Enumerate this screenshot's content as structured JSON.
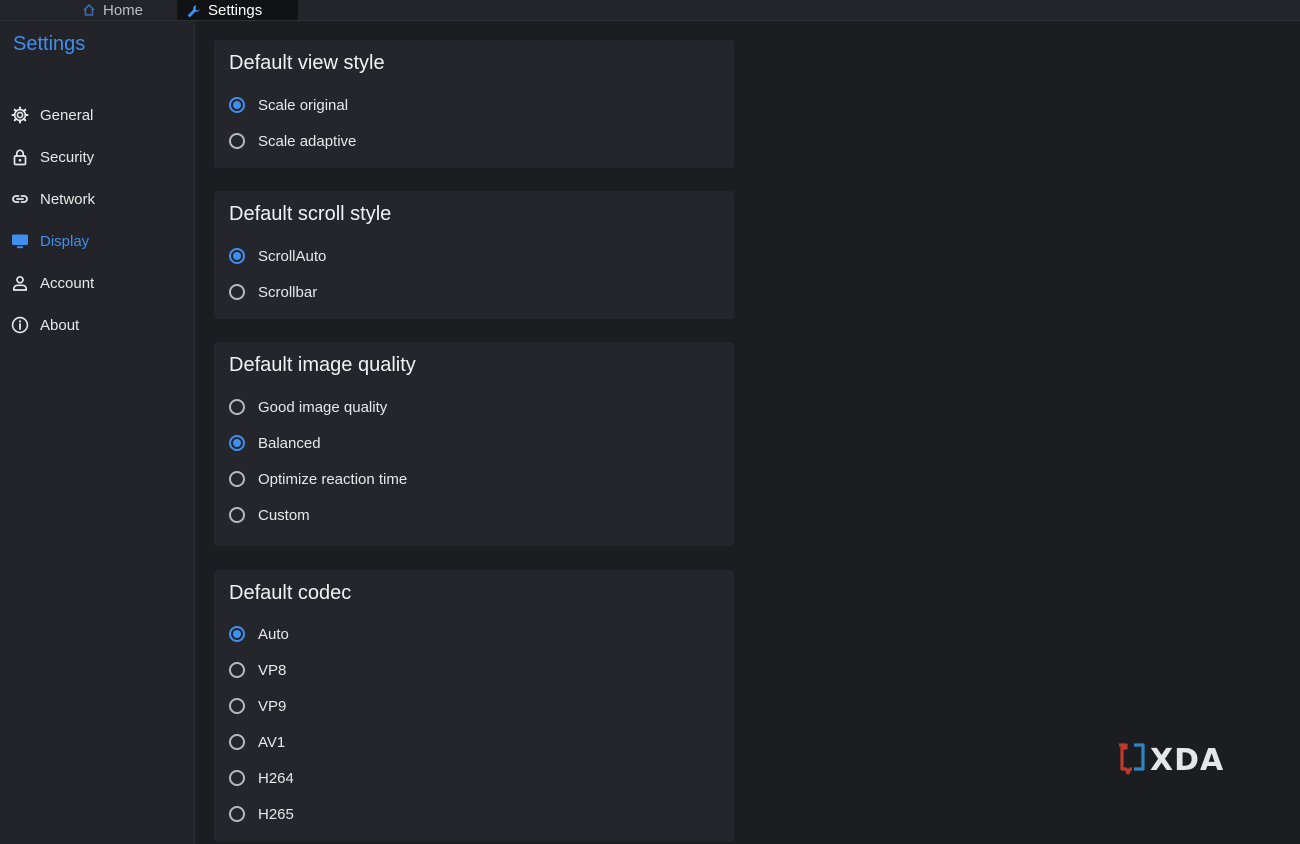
{
  "tabs": {
    "home_label": "Home",
    "settings_label": "Settings"
  },
  "sidebar": {
    "title": "Settings",
    "items": [
      {
        "label": "General",
        "icon": "gear-icon"
      },
      {
        "label": "Security",
        "icon": "lock-icon"
      },
      {
        "label": "Network",
        "icon": "link-icon"
      },
      {
        "label": "Display",
        "icon": "monitor-icon",
        "active": true
      },
      {
        "label": "Account",
        "icon": "person-icon"
      },
      {
        "label": "About",
        "icon": "info-icon"
      }
    ]
  },
  "sections": {
    "view_style": {
      "title": "Default view style",
      "options": [
        "Scale original",
        "Scale adaptive"
      ],
      "selected": "Scale original"
    },
    "scroll_style": {
      "title": "Default scroll style",
      "options": [
        "ScrollAuto",
        "Scrollbar"
      ],
      "selected": "ScrollAuto"
    },
    "image_quality": {
      "title": "Default image quality",
      "options": [
        "Good image quality",
        "Balanced",
        "Optimize reaction time",
        "Custom"
      ],
      "selected": "Balanced"
    },
    "codec": {
      "title": "Default codec",
      "options": [
        "Auto",
        "VP8",
        "VP9",
        "AV1",
        "H264",
        "H265"
      ],
      "selected": "Auto"
    }
  },
  "watermark": {
    "text": "XDA"
  },
  "colors": {
    "accent": "#3e8ff0",
    "background": "#1c1d21",
    "card": "#25262b",
    "sidebar": "#232429"
  }
}
